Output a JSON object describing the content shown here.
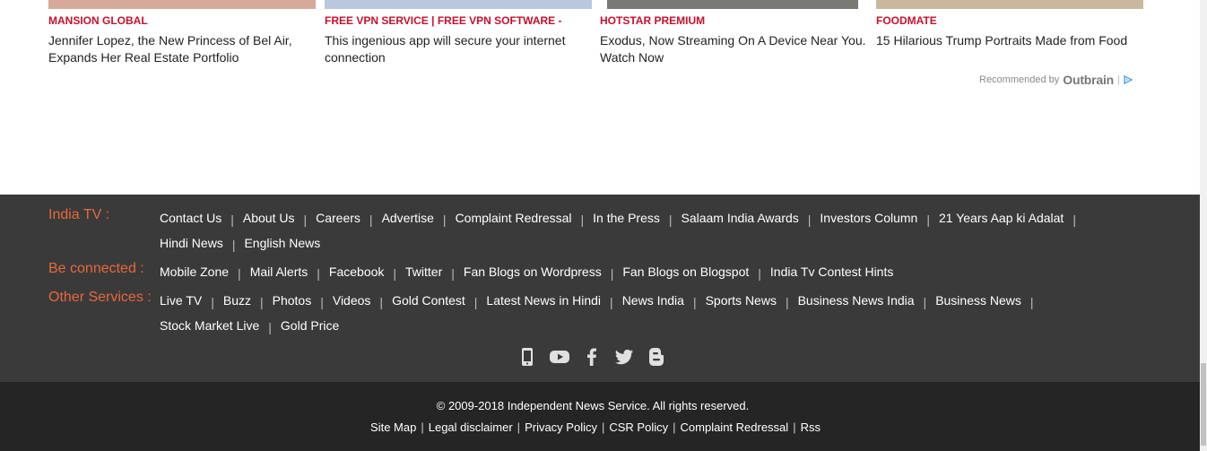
{
  "recommended": {
    "cards": [
      {
        "source": "MANSION GLOBAL",
        "title": "Jennifer Lopez, the New Princess of Bel Air, Expands Her Real Estate Portfolio",
        "thumb_color": "#d7a99a"
      },
      {
        "source": "FREE VPN SERVICE | FREE VPN SOFTWARE -",
        "title": "This ingenious app will secure your internet connection",
        "thumb_color": "#b9c8de"
      },
      {
        "source": "HOTSTAR PREMIUM",
        "title": "Exodus, Now Streaming On A Device Near You. Watch Now",
        "thumb_color": "#7a7a74"
      },
      {
        "source": "FOODMATE",
        "title": "15 Hilarious Trump Portraits Made from Food",
        "thumb_color": "#c9b89d"
      }
    ],
    "recommended_by": "Recommended by",
    "brand": "Outbrain"
  },
  "footer": {
    "india_tv": {
      "label": "India TV :",
      "links": [
        "Contact Us",
        "About Us",
        "Careers",
        "Advertise",
        "Complaint Redressal",
        "In the Press",
        "Salaam India Awards",
        "Investors Column",
        "21 Years Aap ki Adalat",
        "Hindi News",
        "English News"
      ]
    },
    "be_connected": {
      "label": "Be connected :",
      "links": [
        "Mobile Zone",
        "Mail Alerts",
        "Facebook",
        "Twitter",
        "Fan Blogs on Wordpress",
        "Fan Blogs on Blogspot",
        "India Tv Contest Hints"
      ]
    },
    "other_services": {
      "label": "Other Services :",
      "links": [
        "Live TV",
        "Buzz",
        "Photos",
        "Videos",
        "Gold Contest",
        "Latest News in Hindi",
        "News India",
        "Sports News",
        "Business News India",
        "Business News",
        "Stock Market Live",
        "Gold Price"
      ]
    },
    "social_icons": [
      "mobile-icon",
      "youtube-icon",
      "facebook-icon",
      "twitter-icon",
      "blogger-icon"
    ],
    "copyright": "© 2009-2018 Independent News Service. All rights reserved.",
    "bottom_links": [
      "Site Map",
      "Legal disclaimer",
      "Privacy Policy",
      "CSR Policy",
      "Complaint Redressal",
      "Rss"
    ]
  },
  "colors": {
    "accent_label": "#e8683a",
    "source_red": "#c8102e",
    "footer_bg": "#3a3a3a",
    "footer_bottom_bg": "#252525"
  }
}
